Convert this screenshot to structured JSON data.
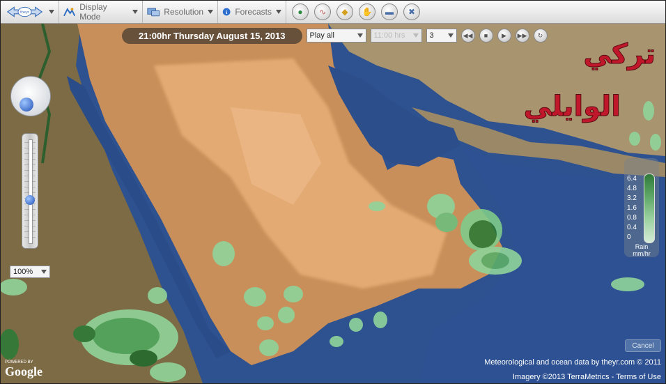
{
  "toolbar": {
    "logo_text": "theyr",
    "display_mode": "Display Mode",
    "resolution": "Resolution",
    "forecasts": "Forecasts",
    "tool_icons": [
      "globe-icon",
      "wave-icon",
      "tag-icon",
      "hand-icon",
      "flag-icon",
      "close-icon"
    ]
  },
  "playback": {
    "time_label": "21:00hr Thursday August 15, 2013",
    "play_mode": "Play all",
    "hour_select": "11:00 hrs",
    "step_select": "3"
  },
  "zoom": {
    "level": "100%"
  },
  "legend": {
    "values": [
      "6.4",
      "4.8",
      "3.2",
      "1.6",
      "0.8",
      "0.4",
      "0"
    ],
    "unit_line1": "Rain",
    "unit_line2": "mm/hr"
  },
  "cancel_label": "Cancel",
  "credits": {
    "data": "Meteorological and ocean data by theyr.com © 2011",
    "imagery": "Imagery ©2013  TerraMetrics - Terms of Use"
  },
  "google": {
    "powered": "POWERED BY",
    "name": "Google"
  },
  "watermark": {
    "line1": "تركي",
    "line2": "الوايلي"
  },
  "colors": {
    "land": "#c9905a",
    "desert": "#e2aa72",
    "sea": "#2d4f8e",
    "rain_light": "#8fd49a",
    "rain_heavy": "#1f6b2a"
  }
}
